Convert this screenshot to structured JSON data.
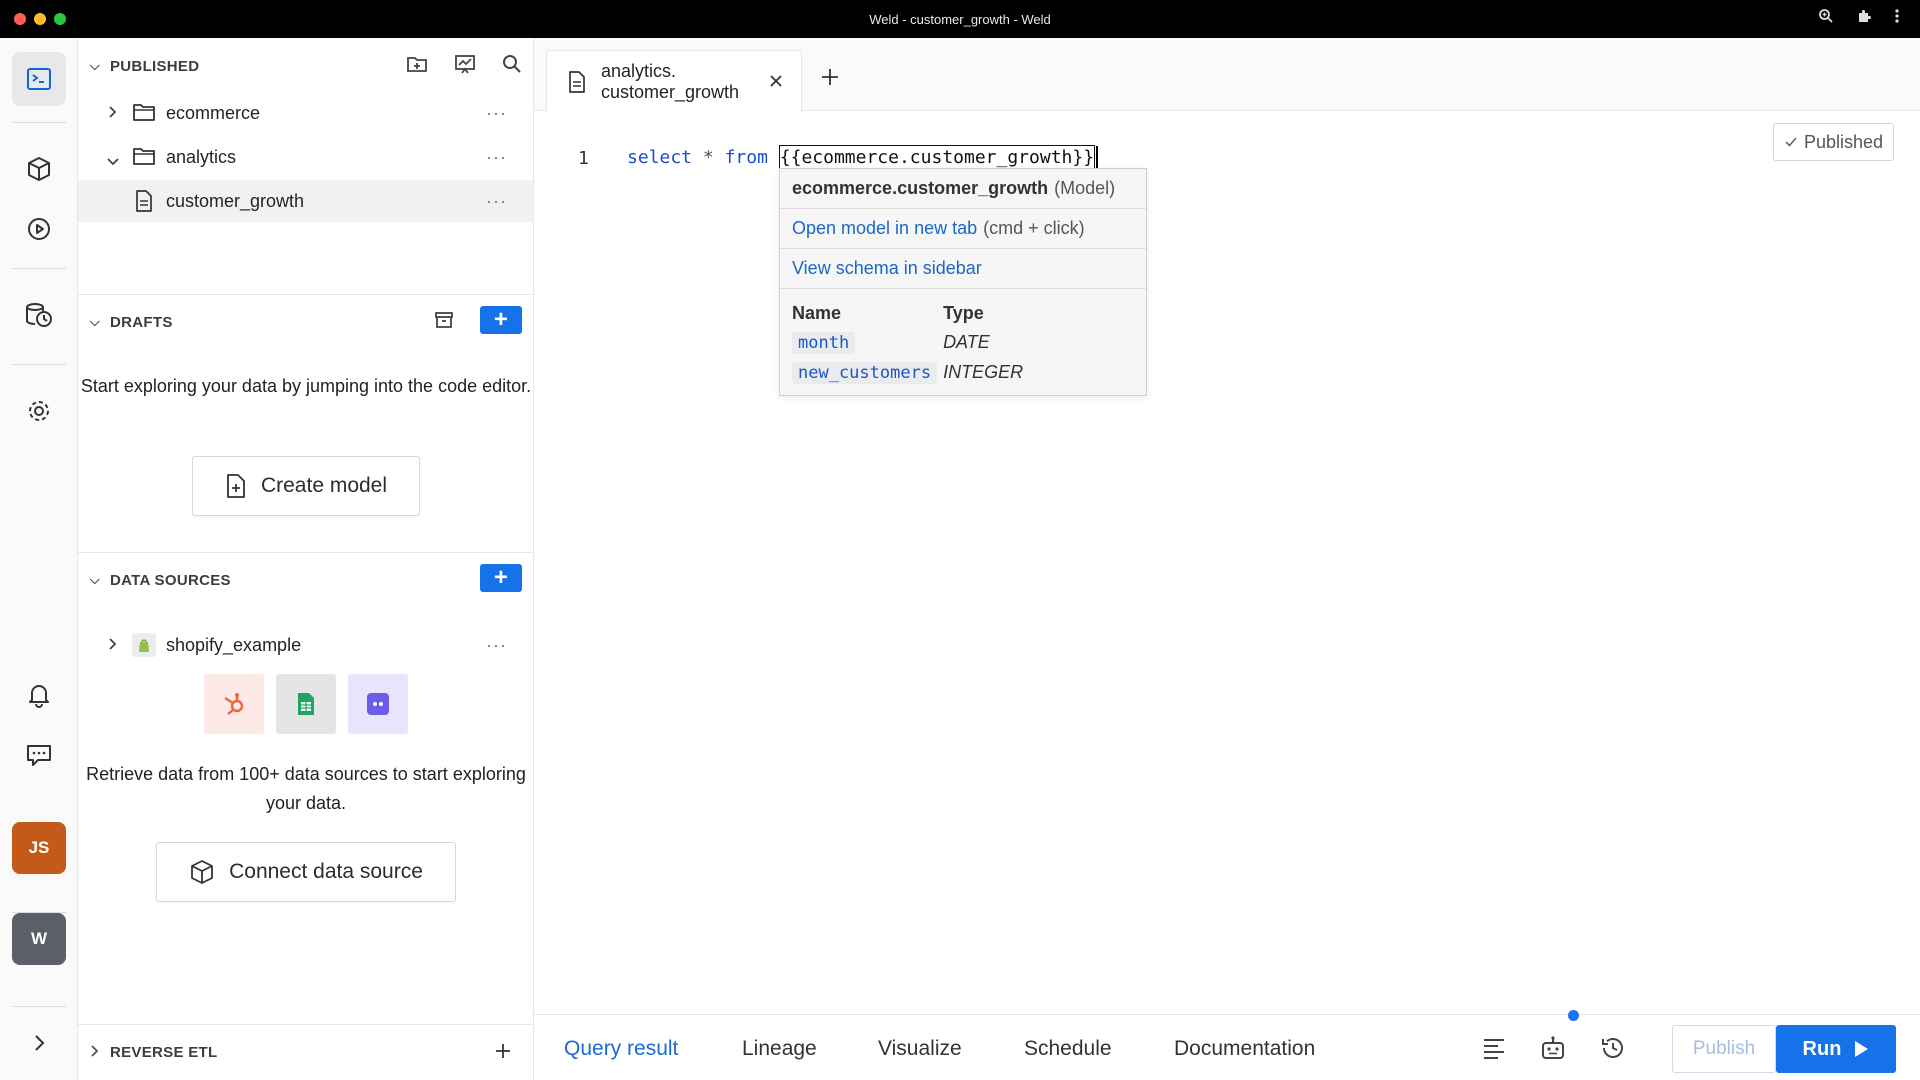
{
  "window": {
    "title": "Weld - customer_growth - Weld"
  },
  "colors": {
    "accent": "#1572e8",
    "avatar_user": "#c35a1a",
    "avatar_workspace": "#5b6068"
  },
  "rail": {
    "items": [
      "editor-icon",
      "models-cube-icon",
      "play-circle-icon",
      "history-db-icon",
      "settings-gear-icon",
      "bell-icon",
      "chat-icon",
      "expand-icon"
    ],
    "user_avatar": "JS",
    "workspace_avatar": "W"
  },
  "sidebar": {
    "published": {
      "header": "PUBLISHED",
      "items": [
        {
          "label": "ecommerce",
          "type": "folder",
          "expanded": false
        },
        {
          "label": "analytics",
          "type": "folder",
          "expanded": true
        },
        {
          "label": "customer_growth",
          "type": "file",
          "selected": true
        }
      ]
    },
    "drafts": {
      "header": "DRAFTS",
      "empty_text": "Start exploring your data by jumping into the code editor.",
      "create_button": "Create model"
    },
    "data_sources": {
      "header": "DATA SOURCES",
      "items": [
        {
          "label": "shopify_example"
        }
      ],
      "empty_text": "Retrieve data from 100+ data sources to start exploring your data.",
      "connect_button": "Connect data source"
    },
    "reverse_etl": {
      "header": "REVERSE ETL"
    }
  },
  "editor": {
    "tab": {
      "line1": "analytics.",
      "line2": "customer_growth"
    },
    "published_label": "Published",
    "line_number": "1",
    "code": {
      "kw_select": "select",
      "star": "*",
      "kw_from": "from",
      "ref": "{{ecommerce.customer_growth}}"
    },
    "popup": {
      "model_name": "ecommerce.customer_growth",
      "model_tag": "(Model)",
      "open_link": "Open model in new tab",
      "open_hint": "(cmd + click)",
      "schema_link": "View schema in sidebar",
      "col_header_name": "Name",
      "col_header_type": "Type",
      "columns": [
        {
          "name": "month",
          "type": "DATE"
        },
        {
          "name": "new_customers",
          "type": "INTEGER"
        }
      ]
    }
  },
  "bottom": {
    "tabs": [
      "Query result",
      "Lineage",
      "Visualize",
      "Schedule",
      "Documentation"
    ],
    "active_tab": "Query result",
    "publish": "Publish",
    "run": "Run"
  }
}
